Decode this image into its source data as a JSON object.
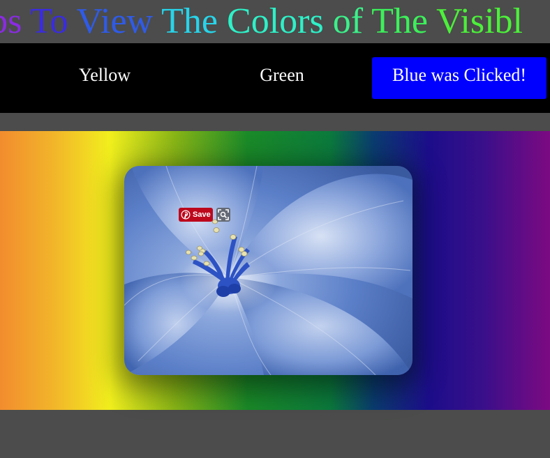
{
  "header": {
    "title_segments": [
      {
        "text": "abs ",
        "color": "#8a2be2"
      },
      {
        "text": "To ",
        "color": "#3a2be2"
      },
      {
        "text": "View ",
        "color": "#2f5bea"
      },
      {
        "text": "The ",
        "color": "#28d4ea"
      },
      {
        "text": "Colors ",
        "color": "#2ef0c8"
      },
      {
        "text": "of ",
        "color": "#3cf08a"
      },
      {
        "text": "The ",
        "color": "#3cf05a"
      },
      {
        "text": "Visibl",
        "color": "#4cf03a"
      }
    ]
  },
  "tabs": [
    {
      "label": "Yellow"
    },
    {
      "label": "Green"
    },
    {
      "label": "Blue was Clicked!"
    }
  ],
  "active_tab_color": "#0000ff",
  "image_overlay": {
    "save_label": "Save",
    "save_icon": "pinterest-icon",
    "lens_icon": "visual-search-icon"
  }
}
